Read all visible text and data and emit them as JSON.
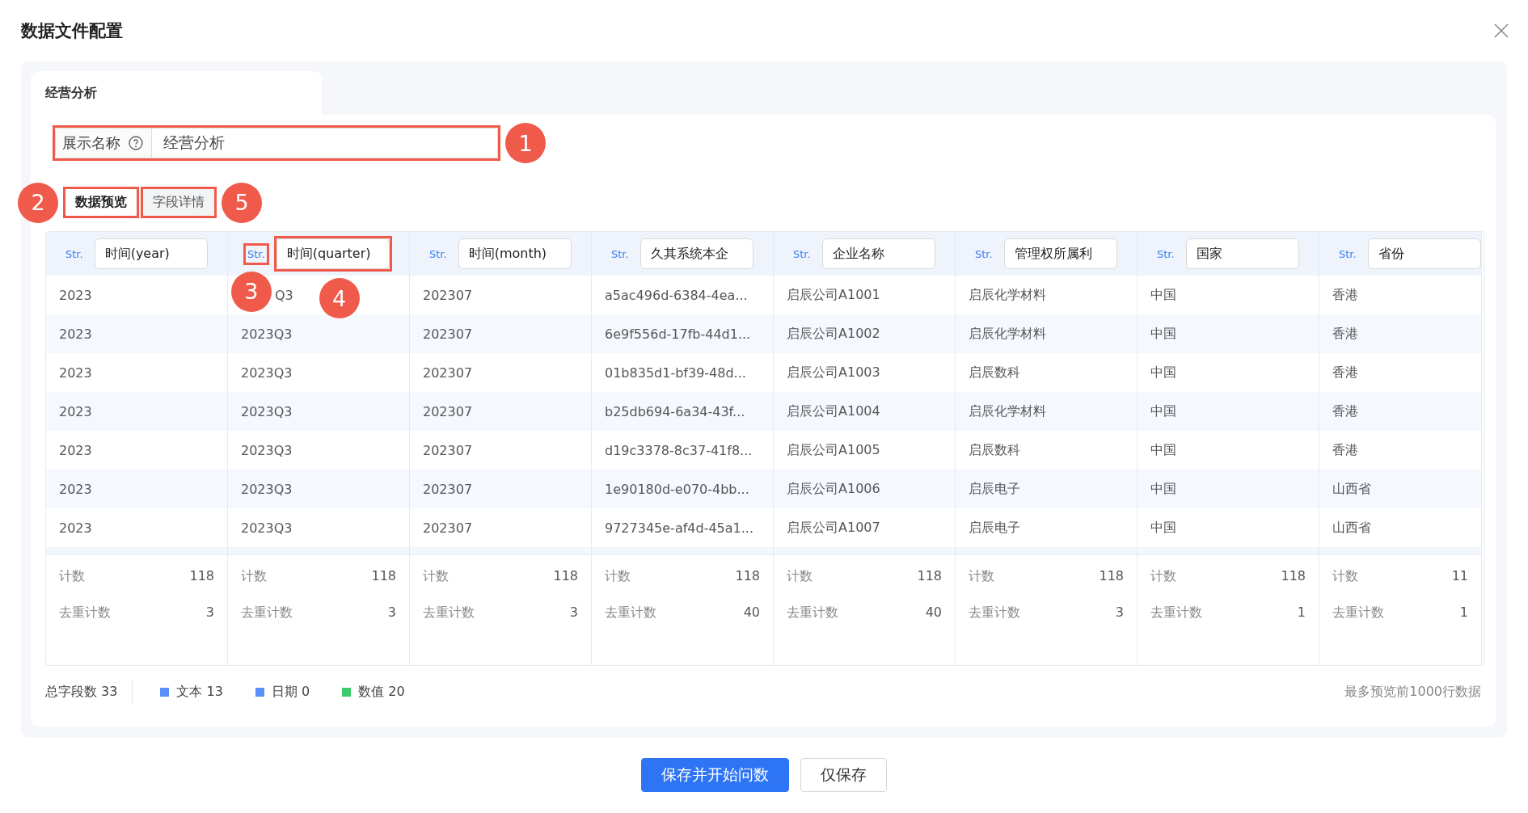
{
  "dialog": {
    "title": "数据文件配置"
  },
  "file_tabs": [
    {
      "label": "经营分析",
      "selected": true
    }
  ],
  "display_name": {
    "label": "展示名称",
    "value": "经营分析",
    "callout": "1"
  },
  "view_tabs": [
    {
      "label": "数据预览",
      "selected": true,
      "callout": "2"
    },
    {
      "label": "字段详情",
      "selected": false,
      "callout": "5"
    }
  ],
  "columns": [
    {
      "type": "Str.",
      "name": "时间(year)",
      "count_label": "计数",
      "count": "118",
      "distinct_label": "去重计数",
      "distinct": "3"
    },
    {
      "type": "Str.",
      "name": "时间(quarter)",
      "type_callout": "3",
      "name_callout": "4",
      "count_label": "计数",
      "count": "118",
      "distinct_label": "去重计数",
      "distinct": "3"
    },
    {
      "type": "Str.",
      "name": "时间(month)",
      "count_label": "计数",
      "count": "118",
      "distinct_label": "去重计数",
      "distinct": "3"
    },
    {
      "type": "Str.",
      "name": "久其系统本企",
      "count_label": "计数",
      "count": "118",
      "distinct_label": "去重计数",
      "distinct": "40"
    },
    {
      "type": "Str.",
      "name": "企业名称",
      "count_label": "计数",
      "count": "118",
      "distinct_label": "去重计数",
      "distinct": "40"
    },
    {
      "type": "Str.",
      "name": "管理权所属利",
      "count_label": "计数",
      "count": "118",
      "distinct_label": "去重计数",
      "distinct": "3"
    },
    {
      "type": "Str.",
      "name": "国家",
      "count_label": "计数",
      "count": "118",
      "distinct_label": "去重计数",
      "distinct": "1"
    },
    {
      "type": "Str.",
      "name": "省份",
      "count_label": "计数",
      "count": "11",
      "distinct_label": "去重计数",
      "distinct": "1"
    }
  ],
  "rows": [
    [
      "2023",
      "Q3",
      "202307",
      "a5ac496d-6384-4ea...",
      "启辰公司A1001",
      "启辰化学材料",
      "中国",
      "香港"
    ],
    [
      "2023",
      "2023Q3",
      "202307",
      "6e9f556d-17fb-44d1...",
      "启辰公司A1002",
      "启辰化学材料",
      "中国",
      "香港"
    ],
    [
      "2023",
      "2023Q3",
      "202307",
      "01b835d1-bf39-48d...",
      "启辰公司A1003",
      "启辰数科",
      "中国",
      "香港"
    ],
    [
      "2023",
      "2023Q3",
      "202307",
      "b25db694-6a34-43f...",
      "启辰公司A1004",
      "启辰化学材料",
      "中国",
      "香港"
    ],
    [
      "2023",
      "2023Q3",
      "202307",
      "d19c3378-8c37-41f8...",
      "启辰公司A1005",
      "启辰数科",
      "中国",
      "香港"
    ],
    [
      "2023",
      "2023Q3",
      "202307",
      "1e90180d-e070-4bb...",
      "启辰公司A1006",
      "启辰电子",
      "中国",
      "山西省"
    ],
    [
      "2023",
      "2023Q3",
      "202307",
      "9727345e-af4d-45a1...",
      "启辰公司A1007",
      "启辰电子",
      "中国",
      "山西省"
    ]
  ],
  "summary": {
    "total": "总字段数 33",
    "legend": [
      {
        "label": "文本 13",
        "color": "#5b8ff9"
      },
      {
        "label": "日期 0",
        "color": "#5b8ff9"
      },
      {
        "label": "数值 20",
        "color": "#3fcb6b"
      }
    ],
    "note": "最多预览前1000行数据"
  },
  "buttons": [
    {
      "label": "保存并开始问数",
      "kind": "primary"
    },
    {
      "label": "仅保存",
      "kind": "default"
    }
  ]
}
